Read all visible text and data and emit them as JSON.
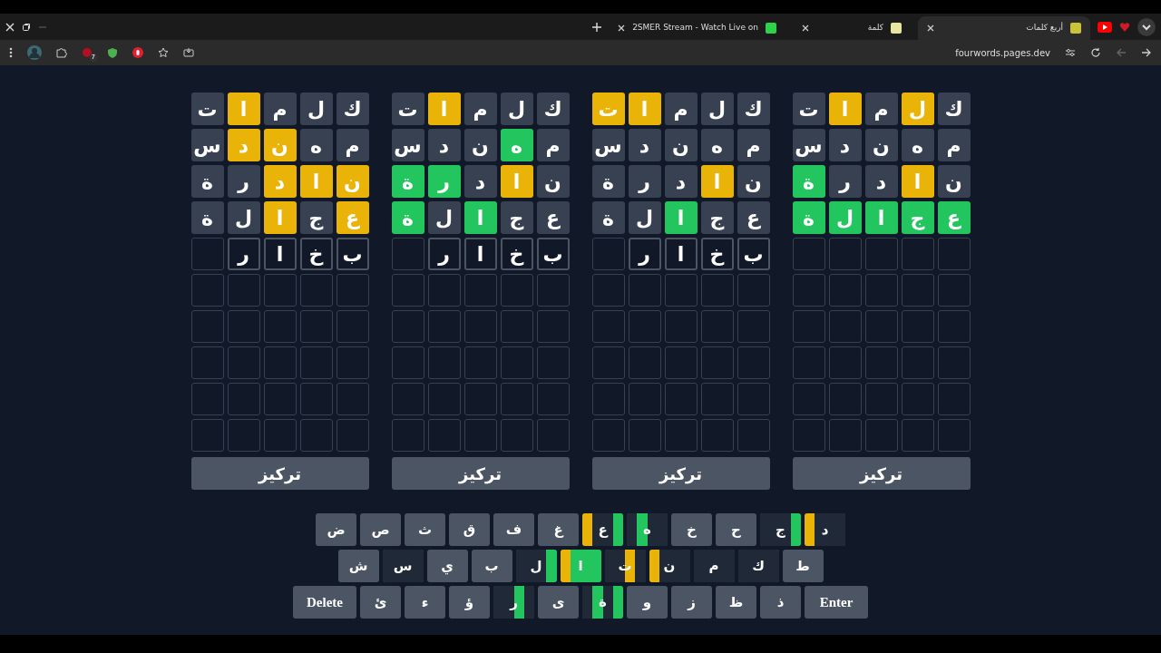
{
  "browser": {
    "tabs": [
      {
        "title": "أربع كلمات",
        "selected": true,
        "color": "#c9c23a"
      },
      {
        "title": "كلمة",
        "selected": false,
        "color": "#e8e4a0"
      },
      {
        "title": "2SMER Stream - Watch Live on",
        "selected": false,
        "color": "#2fd14a"
      }
    ],
    "extension_badge": "7",
    "url": "fourwords.pages.dev"
  },
  "boards": [
    {
      "rows": [
        [
          {
            "letter": "ك",
            "color": "#374151"
          },
          {
            "letter": "ل",
            "color": "#eab308"
          },
          {
            "letter": "م",
            "color": "#374151"
          },
          {
            "letter": "ا",
            "color": "#eab308"
          },
          {
            "letter": "ت",
            "color": "#374151"
          }
        ],
        [
          {
            "letter": "م",
            "color": "#374151"
          },
          {
            "letter": "ه",
            "color": "#374151"
          },
          {
            "letter": "ن",
            "color": "#374151"
          },
          {
            "letter": "د",
            "color": "#374151"
          },
          {
            "letter": "س",
            "color": "#374151"
          }
        ],
        [
          {
            "letter": "ن",
            "color": "#374151"
          },
          {
            "letter": "ا",
            "color": "#eab308"
          },
          {
            "letter": "د",
            "color": "#374151"
          },
          {
            "letter": "ر",
            "color": "#374151"
          },
          {
            "letter": "ة",
            "color": "#22c55e"
          }
        ],
        [
          {
            "letter": "ع",
            "color": "#22c55e"
          },
          {
            "letter": "ج",
            "color": "#22c55e"
          },
          {
            "letter": "ا",
            "color": "#22c55e"
          },
          {
            "letter": "ل",
            "color": "#22c55e"
          },
          {
            "letter": "ة",
            "color": "#22c55e"
          }
        ]
      ],
      "focus_button": "تركيز"
    },
    {
      "rows": [
        [
          {
            "letter": "ك",
            "color": "#374151"
          },
          {
            "letter": "ل",
            "color": "#374151"
          },
          {
            "letter": "م",
            "color": "#374151"
          },
          {
            "letter": "ا",
            "color": "#eab308"
          },
          {
            "letter": "ت",
            "color": "#eab308"
          }
        ],
        [
          {
            "letter": "م",
            "color": "#374151"
          },
          {
            "letter": "ه",
            "color": "#374151"
          },
          {
            "letter": "ن",
            "color": "#374151"
          },
          {
            "letter": "د",
            "color": "#374151"
          },
          {
            "letter": "س",
            "color": "#374151"
          }
        ],
        [
          {
            "letter": "ن",
            "color": "#374151"
          },
          {
            "letter": "ا",
            "color": "#eab308"
          },
          {
            "letter": "د",
            "color": "#374151"
          },
          {
            "letter": "ر",
            "color": "#374151"
          },
          {
            "letter": "ة",
            "color": "#374151"
          }
        ],
        [
          {
            "letter": "ع",
            "color": "#374151"
          },
          {
            "letter": "ج",
            "color": "#374151"
          },
          {
            "letter": "ا",
            "color": "#22c55e"
          },
          {
            "letter": "ل",
            "color": "#374151"
          },
          {
            "letter": "ة",
            "color": "#374151"
          }
        ],
        [
          {
            "letter": "ب"
          },
          {
            "letter": "خ"
          },
          {
            "letter": "ا"
          },
          {
            "letter": "ر"
          }
        ]
      ],
      "focus_button": "تركيز"
    },
    {
      "rows": [
        [
          {
            "letter": "ك",
            "color": "#374151"
          },
          {
            "letter": "ل",
            "color": "#374151"
          },
          {
            "letter": "م",
            "color": "#374151"
          },
          {
            "letter": "ا",
            "color": "#eab308"
          },
          {
            "letter": "ت",
            "color": "#374151"
          }
        ],
        [
          {
            "letter": "م",
            "color": "#374151"
          },
          {
            "letter": "ه",
            "color": "#22c55e"
          },
          {
            "letter": "ن",
            "color": "#374151"
          },
          {
            "letter": "د",
            "color": "#374151"
          },
          {
            "letter": "س",
            "color": "#374151"
          }
        ],
        [
          {
            "letter": "ن",
            "color": "#374151"
          },
          {
            "letter": "ا",
            "color": "#eab308"
          },
          {
            "letter": "د",
            "color": "#374151"
          },
          {
            "letter": "ر",
            "color": "#22c55e"
          },
          {
            "letter": "ة",
            "color": "#22c55e"
          }
        ],
        [
          {
            "letter": "ع",
            "color": "#374151"
          },
          {
            "letter": "ج",
            "color": "#374151"
          },
          {
            "letter": "ا",
            "color": "#22c55e"
          },
          {
            "letter": "ل",
            "color": "#374151"
          },
          {
            "letter": "ة",
            "color": "#22c55e"
          }
        ],
        [
          {
            "letter": "ب"
          },
          {
            "letter": "خ"
          },
          {
            "letter": "ا"
          },
          {
            "letter": "ر"
          }
        ]
      ],
      "focus_button": "تركيز"
    },
    {
      "rows": [
        [
          {
            "letter": "ك",
            "color": "#374151"
          },
          {
            "letter": "ل",
            "color": "#374151"
          },
          {
            "letter": "م",
            "color": "#374151"
          },
          {
            "letter": "ا",
            "color": "#eab308"
          },
          {
            "letter": "ت",
            "color": "#374151"
          }
        ],
        [
          {
            "letter": "م",
            "color": "#374151"
          },
          {
            "letter": "ه",
            "color": "#374151"
          },
          {
            "letter": "ن",
            "color": "#eab308"
          },
          {
            "letter": "د",
            "color": "#eab308"
          },
          {
            "letter": "س",
            "color": "#374151"
          }
        ],
        [
          {
            "letter": "ن",
            "color": "#eab308"
          },
          {
            "letter": "ا",
            "color": "#eab308"
          },
          {
            "letter": "د",
            "color": "#eab308"
          },
          {
            "letter": "ر",
            "color": "#374151"
          },
          {
            "letter": "ة",
            "color": "#374151"
          }
        ],
        [
          {
            "letter": "ع",
            "color": "#eab308"
          },
          {
            "letter": "ج",
            "color": "#374151"
          },
          {
            "letter": "ا",
            "color": "#eab308"
          },
          {
            "letter": "ل",
            "color": "#374151"
          },
          {
            "letter": "ة",
            "color": "#374151"
          }
        ],
        [
          {
            "letter": "ب"
          },
          {
            "letter": "خ"
          },
          {
            "letter": "ا"
          },
          {
            "letter": "ر"
          }
        ]
      ],
      "focus_button": "تركيز"
    }
  ],
  "keyboard": {
    "rows": [
      [
        {
          "label": "د",
          "kind": "letter",
          "strips": [
            {
              "color": "#1f2937"
            },
            {
              "color": "#1f2937"
            },
            {
              "color": "#1f2937"
            },
            {
              "color": "#eab308"
            }
          ]
        },
        {
          "label": "ج",
          "kind": "letter",
          "strips": [
            {
              "color": "#22c55e"
            },
            {
              "color": "#1f2937"
            },
            {
              "color": "#1f2937"
            },
            {
              "color": "#1f2937"
            }
          ]
        },
        {
          "label": "ح",
          "kind": "letter"
        },
        {
          "label": "خ",
          "kind": "letter"
        },
        {
          "label": "ه",
          "kind": "letter",
          "strips": [
            {
              "color": "#1f2937"
            },
            {
              "color": "#1f2937"
            },
            {
              "color": "#22c55e"
            },
            {
              "color": "#1f2937"
            }
          ]
        },
        {
          "label": "ع",
          "kind": "letter",
          "strips": [
            {
              "color": "#22c55e"
            },
            {
              "color": "#1f2937"
            },
            {
              "color": "#1f2937"
            },
            {
              "color": "#eab308"
            }
          ]
        },
        {
          "label": "غ",
          "kind": "letter"
        },
        {
          "label": "ف",
          "kind": "letter"
        },
        {
          "label": "ق",
          "kind": "letter"
        },
        {
          "label": "ث",
          "kind": "letter"
        },
        {
          "label": "ص",
          "kind": "letter"
        },
        {
          "label": "ض",
          "kind": "letter"
        }
      ],
      [
        {
          "label": "ط",
          "kind": "letter"
        },
        {
          "label": "ك",
          "kind": "letter",
          "strips": [
            {
              "color": "#1f2937"
            },
            {
              "color": "#1f2937"
            },
            {
              "color": "#1f2937"
            },
            {
              "color": "#1f2937"
            }
          ]
        },
        {
          "label": "م",
          "kind": "letter",
          "strips": [
            {
              "color": "#1f2937"
            },
            {
              "color": "#1f2937"
            },
            {
              "color": "#1f2937"
            },
            {
              "color": "#1f2937"
            }
          ]
        },
        {
          "label": "ن",
          "kind": "letter",
          "strips": [
            {
              "color": "#1f2937"
            },
            {
              "color": "#1f2937"
            },
            {
              "color": "#1f2937"
            },
            {
              "color": "#eab308"
            }
          ]
        },
        {
          "label": "ت",
          "kind": "letter",
          "strips": [
            {
              "color": "#1f2937"
            },
            {
              "color": "#eab308"
            },
            {
              "color": "#1f2937"
            },
            {
              "color": "#1f2937"
            }
          ]
        },
        {
          "label": "ا",
          "kind": "letter",
          "strips": [
            {
              "color": "#22c55e"
            },
            {
              "color": "#22c55e"
            },
            {
              "color": "#22c55e"
            },
            {
              "color": "#eab308"
            }
          ]
        },
        {
          "label": "ل",
          "kind": "letter",
          "strips": [
            {
              "color": "#22c55e"
            },
            {
              "color": "#1f2937"
            },
            {
              "color": "#1f2937"
            },
            {
              "color": "#1f2937"
            }
          ]
        },
        {
          "label": "ب",
          "kind": "letter"
        },
        {
          "label": "ي",
          "kind": "letter"
        },
        {
          "label": "س",
          "kind": "letter",
          "strips": [
            {
              "color": "#1f2937"
            },
            {
              "color": "#1f2937"
            },
            {
              "color": "#1f2937"
            },
            {
              "color": "#1f2937"
            }
          ]
        },
        {
          "label": "ش",
          "kind": "letter"
        }
      ],
      [
        {
          "label": "Enter",
          "kind": "action"
        },
        {
          "label": "ذ",
          "kind": "letter"
        },
        {
          "label": "ظ",
          "kind": "letter"
        },
        {
          "label": "ز",
          "kind": "letter"
        },
        {
          "label": "و",
          "kind": "letter"
        },
        {
          "label": "ة",
          "kind": "letter",
          "strips": [
            {
              "color": "#22c55e"
            },
            {
              "color": "#1f2937"
            },
            {
              "color": "#22c55e"
            },
            {
              "color": "#1f2937"
            }
          ]
        },
        {
          "label": "ى",
          "kind": "letter"
        },
        {
          "label": "ر",
          "kind": "letter",
          "strips": [
            {
              "color": "#1f2937"
            },
            {
              "color": "#22c55e"
            },
            {
              "color": "#1f2937"
            },
            {
              "color": "#1f2937"
            }
          ]
        },
        {
          "label": "ؤ",
          "kind": "letter"
        },
        {
          "label": "ء",
          "kind": "letter"
        },
        {
          "label": "ئ",
          "kind": "letter"
        },
        {
          "label": "Delete",
          "kind": "action"
        }
      ]
    ]
  }
}
